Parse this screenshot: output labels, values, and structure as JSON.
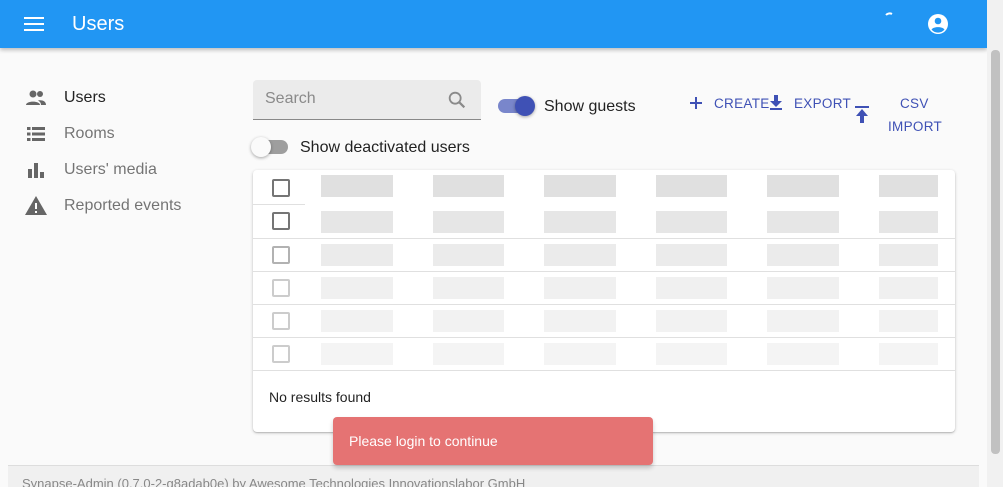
{
  "appbar": {
    "title": "Users",
    "menu_icon": "menu-icon",
    "account_icon": "account-circle-icon"
  },
  "sidebar": {
    "items": [
      {
        "label": "Users",
        "icon": "people-icon",
        "active": true
      },
      {
        "label": "Rooms",
        "icon": "list-icon",
        "active": false
      },
      {
        "label": "Users' media",
        "icon": "bar-chart-icon",
        "active": false
      },
      {
        "label": "Reported events",
        "icon": "warning-icon",
        "active": false
      }
    ]
  },
  "toolbar": {
    "search_placeholder": "Search",
    "show_guests_label": "Show guests",
    "show_guests_on": true,
    "show_deactivated_label": "Show deactivated users",
    "show_deactivated_on": false,
    "create_label": "CREATE",
    "export_label": "EXPORT",
    "import_label_line1": "CSV",
    "import_label_line2": "IMPORT"
  },
  "table": {
    "empty_message": "No results found"
  },
  "footer": {
    "text": "Synapse-Admin (0.7.0-2-g8adab0e) by Awesome Technologies Innovationslabor GmbH"
  },
  "snackbar": {
    "message": "Please login to continue"
  },
  "colors": {
    "appbar": "#2196f3",
    "primary": "#3f51b5",
    "snackbar": "#e57373"
  }
}
